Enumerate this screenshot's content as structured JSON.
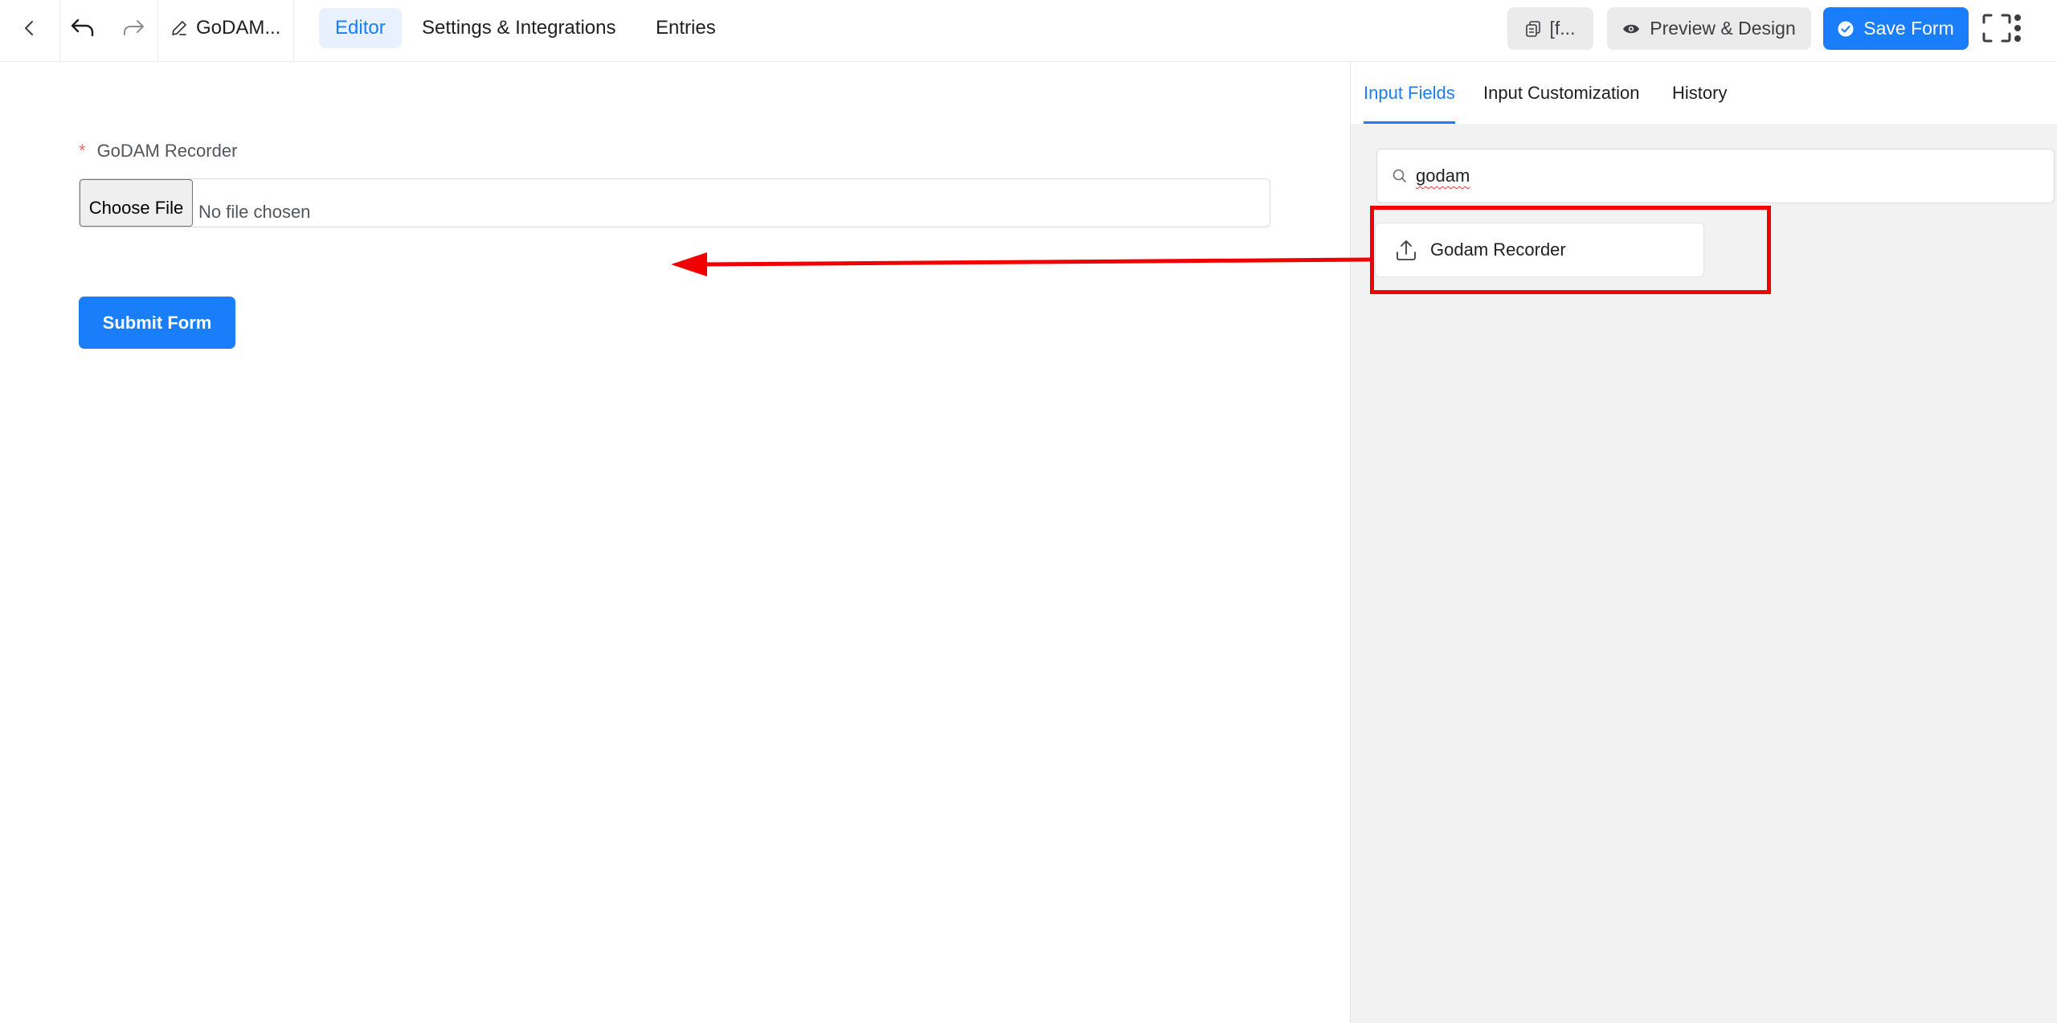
{
  "topbar": {
    "form_title": "GoDAM...",
    "nav_tabs": [
      {
        "label": "Editor",
        "active": true
      },
      {
        "label": "Settings & Integrations",
        "active": false
      },
      {
        "label": "Entries",
        "active": false
      }
    ],
    "shortcode_label": "[f...",
    "preview_label": "Preview & Design",
    "save_label": "Save Form",
    "icons": [
      "back-icon",
      "undo-icon",
      "redo-icon",
      "edit-pencil-icon",
      "copy-icon",
      "eye-icon",
      "check-circle-icon",
      "fullscreen-icon",
      "more-vertical-icon"
    ]
  },
  "canvas": {
    "field_required_mark": "*",
    "field_label": "GoDAM Recorder",
    "choose_file_label": "Choose File",
    "no_file_text": "No file chosen",
    "submit_label": "Submit Form"
  },
  "panel": {
    "tabs": [
      {
        "label": "Input Fields",
        "active": true
      },
      {
        "label": "Input Customization",
        "active": false
      },
      {
        "label": "History",
        "active": false
      }
    ],
    "search_value": "godam",
    "results": [
      {
        "label": "Godam Recorder",
        "icon": "upload-icon"
      }
    ]
  },
  "annotation": {
    "color": "#f00000"
  },
  "colors": {
    "accent": "#1a7efb",
    "panel_bg": "#f2f2f2",
    "required": "#f56c6c"
  }
}
